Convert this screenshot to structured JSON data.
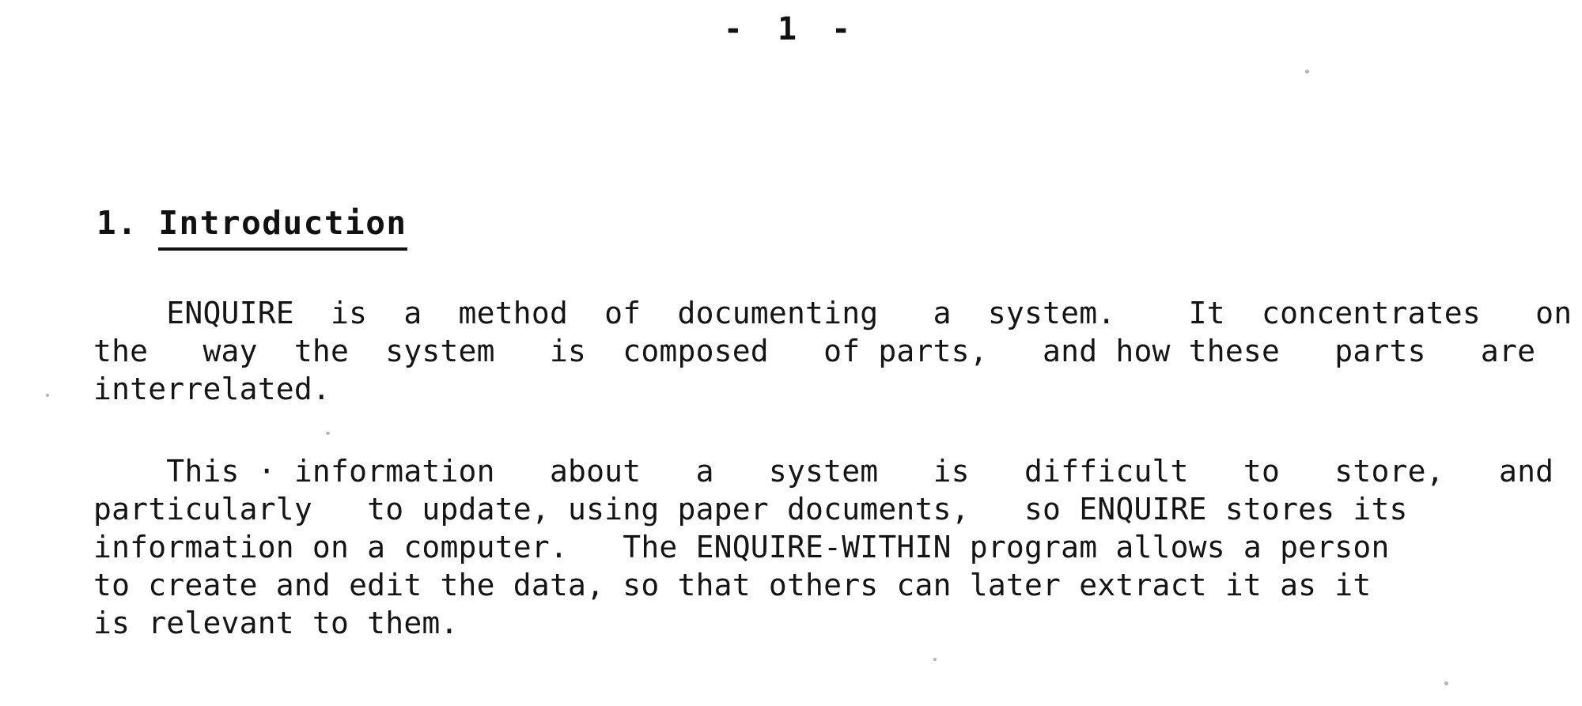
{
  "document": {
    "page_header": "-  1  -",
    "page_number": "1",
    "heading": {
      "number": "1.",
      "title": "Introduction"
    },
    "paragraphs": [
      {
        "id": "para-1",
        "lines": [
          "    ENQUIRE  is  a  method  of  documenting   a  system.    It  concentrates   on",
          "the   way  the  system   is  composed   of parts,   and how these   parts   are",
          "interrelated."
        ],
        "plain_text": "ENQUIRE is a method of documenting a system. It concentrates on the way the system is composed of parts, and how these parts are interrelated."
      },
      {
        "id": "para-2",
        "lines": [
          "    This · information   about   a   system   is   difficult   to   store,   and",
          "particularly   to update, using paper documents,   so ENQUIRE stores its",
          "information on a computer.   The ENQUIRE-WITHIN program allows a person",
          "to create and edit the data, so that others can later extract it as it",
          "is relevant to them."
        ],
        "plain_text": "This information about a system is difficult to store, and particularly to update, using paper documents, so ENQUIRE stores its information on a computer. The ENQUIRE-WITHIN program allows a person to create and edit the data, so that others can later extract it as it is relevant to them."
      }
    ],
    "colors": {
      "ink": "#151515",
      "paper": "#ffffff"
    }
  }
}
